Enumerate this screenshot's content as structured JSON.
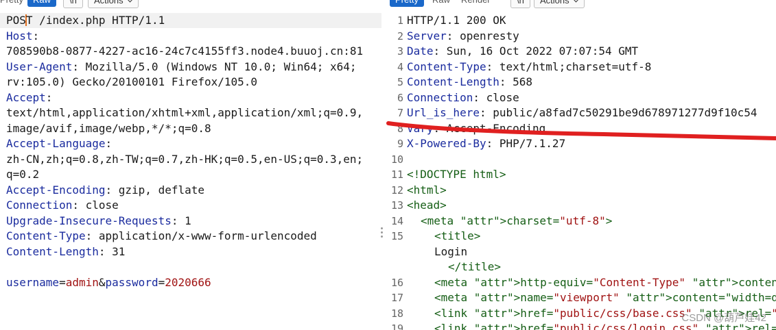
{
  "request_panel": {
    "tabs": {
      "pretty": "Pretty",
      "raw": "Raw",
      "newline": "\\n",
      "actions": "Actions"
    },
    "first_line_method": "POS",
    "first_line_method_rest": "T",
    "first_line_rest": " /index.php HTTP/1.1",
    "lines": [
      {
        "key": "Host",
        "sep": ":",
        "val": ""
      },
      {
        "plain": "708590b8-0877-4227-ac16-24c7c4155ff3.node4.buuoj.cn:81"
      },
      {
        "key": "User-Agent",
        "sep": ":",
        "val": " Mozilla/5.0 (Windows NT 10.0; Win64; x64;"
      },
      {
        "plain": "rv:105.0) Gecko/20100101 Firefox/105.0"
      },
      {
        "key": "Accept",
        "sep": ":",
        "val": ""
      },
      {
        "plain": "text/html,application/xhtml+xml,application/xml;q=0.9,"
      },
      {
        "plain": "image/avif,image/webp,*/*;q=0.8"
      },
      {
        "key": "Accept-Language",
        "sep": ":",
        "val": ""
      },
      {
        "plain": "zh-CN,zh;q=0.8,zh-TW;q=0.7,zh-HK;q=0.5,en-US;q=0.3,en;"
      },
      {
        "plain": "q=0.2"
      },
      {
        "key": "Accept-Encoding",
        "sep": ":",
        "val": " gzip, deflate"
      },
      {
        "key": "Connection",
        "sep": ":",
        "val": " close"
      },
      {
        "key": "Upgrade-Insecure-Requests",
        "sep": ":",
        "val": " 1"
      },
      {
        "key": "Content-Type",
        "sep": ":",
        "val": " application/x-www-form-urlencoded"
      },
      {
        "key": "Content-Length",
        "sep": ":",
        "val": " 31"
      }
    ],
    "body": {
      "p1": "username",
      "v1": "admin",
      "amp": "&",
      "p2": "password",
      "v2": "2020666",
      "eq": "="
    }
  },
  "response_panel": {
    "tabs": {
      "pretty": "Pretty",
      "raw": "Raw",
      "render": "Render",
      "newline": "\\n",
      "actions": "Actions"
    },
    "lines": [
      {
        "n": "1",
        "plain": "HTTP/1.1 200 OK"
      },
      {
        "n": "2",
        "key": "Server",
        "val": " openresty"
      },
      {
        "n": "3",
        "key": "Date",
        "val": " Sun, 16 Oct 2022 07:07:54 GMT"
      },
      {
        "n": "4",
        "key": "Content-Type",
        "val": " text/html;charset=utf-8"
      },
      {
        "n": "5",
        "key": "Content-Length",
        "val": " 568"
      },
      {
        "n": "6",
        "key": "Connection",
        "val": " close"
      },
      {
        "n": "7",
        "key": "Url_is_here",
        "val": " public/a8fad7c50291be9d678971277d9f10c54"
      },
      {
        "n": "8",
        "key": "Vary",
        "val": " Accept-Encoding"
      },
      {
        "n": "9",
        "key": "X-Powered-By",
        "val": " PHP/7.1.27"
      },
      {
        "n": "10",
        "plain": ""
      },
      {
        "n": "11",
        "html": "<!DOCTYPE html>"
      },
      {
        "n": "12",
        "html": "<html>"
      },
      {
        "n": "13",
        "html": "<head>"
      },
      {
        "n": "14",
        "html": "<meta charset=\"utf-8\">"
      },
      {
        "n": "15",
        "html": "<title>"
      },
      {
        "n": "",
        "plain": "Login"
      },
      {
        "n": "",
        "html": "</title>"
      },
      {
        "n": "16",
        "html": "<meta http-equiv=\"Content-Type\" content=\"text/htm"
      },
      {
        "n": "17",
        "html": "<meta name=\"viewport\" content=\"width=device-width"
      },
      {
        "n": "18",
        "html": "<link href=\"public/css/base.css\" rel=\"stylesheet\""
      },
      {
        "n": "19",
        "html": "<link href=\"public/css/login.css\" rel=\"stylesheet\""
      }
    ]
  },
  "watermark": "CSDN @葫芦娃42",
  "colors": {
    "header_key": "#1a2b9e",
    "param_value": "#a01313",
    "tag": "#155e15",
    "annotation": "#e02020",
    "active_tab": "#1a68c9"
  }
}
